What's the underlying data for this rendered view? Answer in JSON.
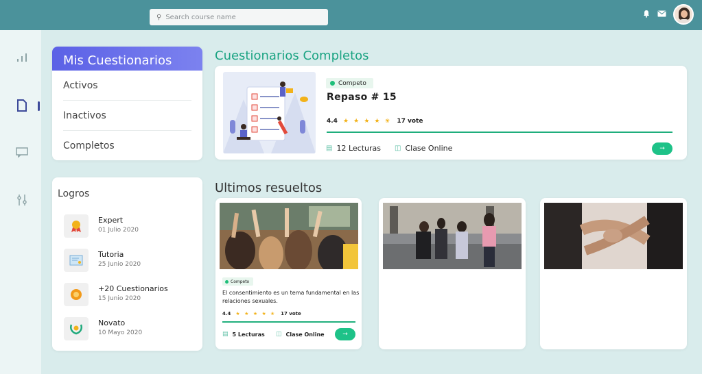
{
  "search": {
    "placeholder": "Search course name",
    "icon": "search-icon"
  },
  "top_icons": [
    "bell-icon",
    "mail-icon",
    "avatar"
  ],
  "sidebar_icons": [
    "bar-chart-icon",
    "document-icon",
    "chat-icon",
    "sliders-icon"
  ],
  "mis_cuestionarios": {
    "title": "Mis Cuestionarios",
    "items": [
      "Activos",
      "Inactivos",
      "Completos"
    ]
  },
  "logros": {
    "title": "Logros",
    "items": [
      {
        "name": "Expert",
        "date": "01 Julio 2020",
        "icon": "medal-icon"
      },
      {
        "name": "Tutoria",
        "date": "25 Junio 2020",
        "icon": "certificate-icon"
      },
      {
        "name": "+20 Cuestionarios",
        "date": "15 Junio 2020",
        "icon": "coin-icon"
      },
      {
        "name": "Novato",
        "date": "10 Mayo 2020",
        "icon": "laurel-icon"
      }
    ]
  },
  "completos": {
    "heading": "Cuestionarios Completos",
    "card": {
      "badge": "Competo",
      "title": "Repaso  # 15",
      "rating": "4.4",
      "stars": "★ ★ ★ ★ ✬",
      "votes": "17 vote",
      "lecturas": "12 Lecturas",
      "clase": "Clase Online",
      "button": "→"
    }
  },
  "ultimos": {
    "heading": "Ultimos resueltos",
    "card1": {
      "badge": "Competo",
      "text": "El consentimiento es un tema fundamental en las relaciones sexuales.",
      "rating": "4.4",
      "stars": "★ ★ ★ ★ ✬",
      "votes": "17 vote",
      "lecturas": "5 Lecturas",
      "clase": "Clase Online",
      "button": "→"
    }
  },
  "colors": {
    "topbar": "#4b929b",
    "accent_green": "#1ec288",
    "header_purple": "#5b61e6",
    "star": "#f2b21a"
  }
}
